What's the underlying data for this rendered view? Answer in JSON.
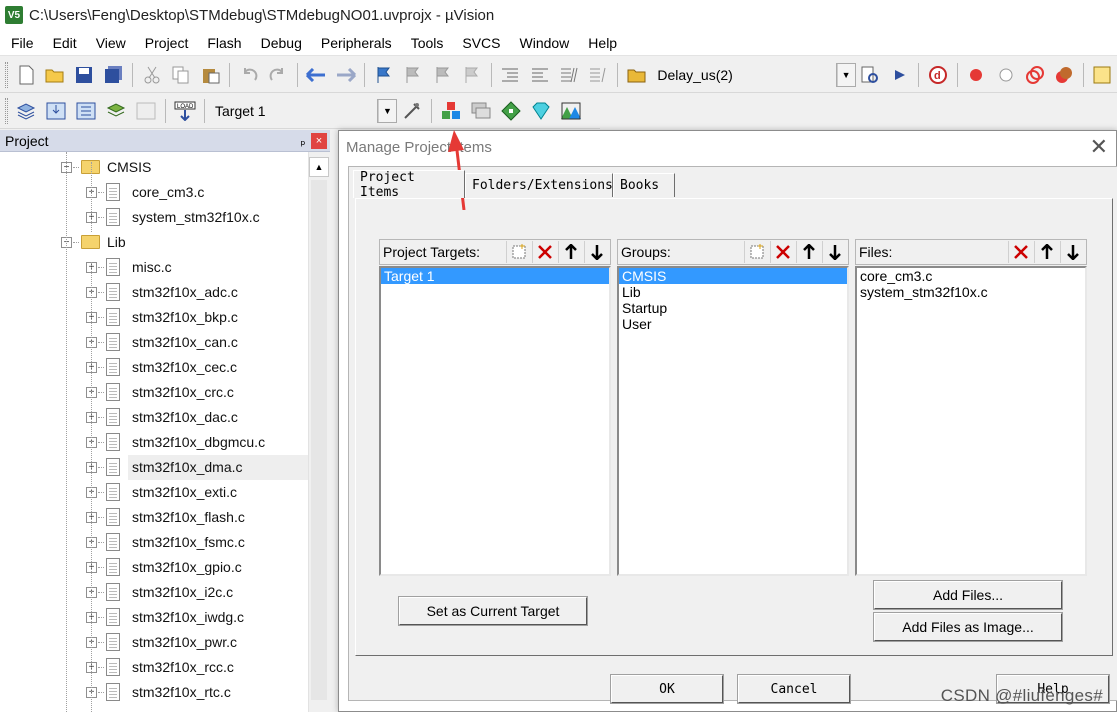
{
  "window": {
    "title": "C:\\Users\\Feng\\Desktop\\STMdebug\\STMdebugNO01.uvprojx - µVision",
    "app_icon": "V5"
  },
  "menu": [
    "File",
    "Edit",
    "View",
    "Project",
    "Flash",
    "Debug",
    "Peripherals",
    "Tools",
    "SVCS",
    "Window",
    "Help"
  ],
  "toolbar": {
    "function_combo": "Delay_us(2)",
    "target_combo": "Target 1",
    "load_label": "LOAD"
  },
  "project_panel": {
    "title": "Project",
    "pin": "ᵖ",
    "close": "×",
    "tree": [
      {
        "type": "folder",
        "label": "CMSIS"
      },
      {
        "type": "file",
        "label": "core_cm3.c"
      },
      {
        "type": "file",
        "label": "system_stm32f10x.c"
      },
      {
        "type": "folder",
        "label": "Lib"
      },
      {
        "type": "file",
        "label": "misc.c"
      },
      {
        "type": "file",
        "label": "stm32f10x_adc.c"
      },
      {
        "type": "file",
        "label": "stm32f10x_bkp.c"
      },
      {
        "type": "file",
        "label": "stm32f10x_can.c"
      },
      {
        "type": "file",
        "label": "stm32f10x_cec.c"
      },
      {
        "type": "file",
        "label": "stm32f10x_crc.c"
      },
      {
        "type": "file",
        "label": "stm32f10x_dac.c"
      },
      {
        "type": "file",
        "label": "stm32f10x_dbgmcu.c"
      },
      {
        "type": "file",
        "label": "stm32f10x_dma.c",
        "selected": true
      },
      {
        "type": "file",
        "label": "stm32f10x_exti.c"
      },
      {
        "type": "file",
        "label": "stm32f10x_flash.c"
      },
      {
        "type": "file",
        "label": "stm32f10x_fsmc.c"
      },
      {
        "type": "file",
        "label": "stm32f10x_gpio.c"
      },
      {
        "type": "file",
        "label": "stm32f10x_i2c.c"
      },
      {
        "type": "file",
        "label": "stm32f10x_iwdg.c"
      },
      {
        "type": "file",
        "label": "stm32f10x_pwr.c"
      },
      {
        "type": "file",
        "label": "stm32f10x_rcc.c"
      },
      {
        "type": "file",
        "label": "stm32f10x_rtc.c"
      }
    ]
  },
  "dialog": {
    "title": "Manage Project Items",
    "close": "✕",
    "tabs": [
      "Project Items",
      "Folders/Extensions",
      "Books"
    ],
    "targets_label": "Project Targets:",
    "groups_label": "Groups:",
    "files_label": "Files:",
    "targets": [
      "Target 1"
    ],
    "groups": [
      "CMSIS",
      "Lib",
      "Startup",
      "User"
    ],
    "files": [
      "core_cm3.c",
      "system_stm32f10x.c"
    ],
    "set_current_target": "Set as Current Target",
    "add_files": "Add Files...",
    "add_files_image": "Add Files as Image...",
    "ok": "OK",
    "cancel": "Cancel",
    "help": "Help"
  },
  "watermark": "CSDN @#liufenges#",
  "colors": {
    "selection": "#3399ff",
    "delete_red": "#cc0000",
    "annotation_arrow": "#e53935",
    "panel_header": "#d6dbe9"
  }
}
